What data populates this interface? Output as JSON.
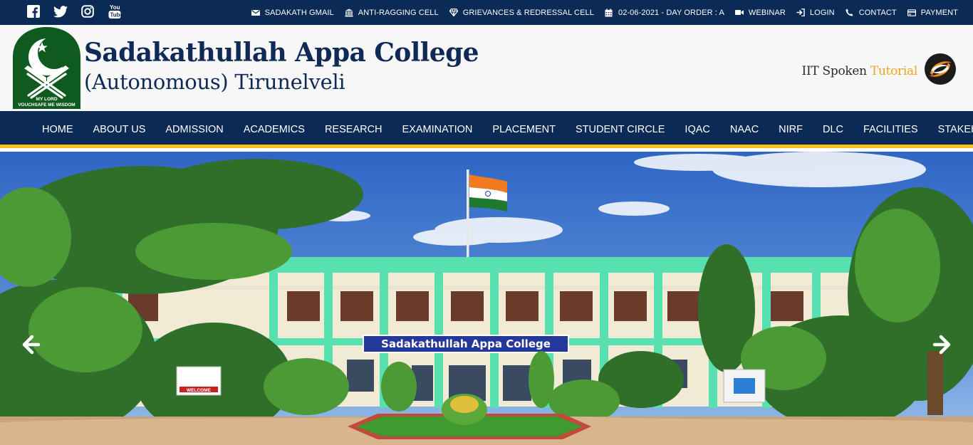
{
  "social": {
    "icons": [
      "facebook-icon",
      "twitter-icon",
      "instagram-icon",
      "youtube-icon"
    ]
  },
  "topbar": {
    "links": [
      {
        "icon": "envelope-icon",
        "label": "SADAKATH GMAIL"
      },
      {
        "icon": "bank-icon",
        "label": "ANTI-RAGGING CELL"
      },
      {
        "icon": "diamond-icon",
        "label": "GRIEVANCES & REDRESSAL CELL"
      },
      {
        "icon": "calendar-icon",
        "label": "02-06-2021 - DAY ORDER : A"
      },
      {
        "icon": "video-camera-icon",
        "label": "WEBINAR"
      },
      {
        "icon": "login-icon",
        "label": "LOGIN"
      },
      {
        "icon": "phone-icon",
        "label": "CONTACT"
      },
      {
        "icon": "credit-card-icon",
        "label": "PAYMENT"
      }
    ]
  },
  "header": {
    "title_line1": "Sadakathullah Appa College",
    "title_line2": "(Autonomous) Tirunelveli",
    "logo_motto_line1": "MY LORD",
    "logo_motto_line2": "VOUCHSAFE ME WISDOM",
    "spoken_tutorial_prefix": "IIT Spoken",
    "spoken_tutorial_suffix": "Tutorial"
  },
  "nav": {
    "items": [
      "HOME",
      "ABOUT US",
      "ADMISSION",
      "ACADEMICS",
      "RESEARCH",
      "EXAMINATION",
      "PLACEMENT",
      "STUDENT CIRCLE",
      "IQAC",
      "NAAC",
      "NIRF",
      "DLC",
      "FACILITIES",
      "STAKEHOLDERS"
    ]
  },
  "hero": {
    "building_sign": "Sadakathullah Appa College",
    "welcome_sign": "WELCOME"
  },
  "colors": {
    "navy": "#0b2a55",
    "accent_yellow": "#f5c21a",
    "logo_green": "#0f5a1e",
    "tutorial_orange": "#f0a41d"
  }
}
